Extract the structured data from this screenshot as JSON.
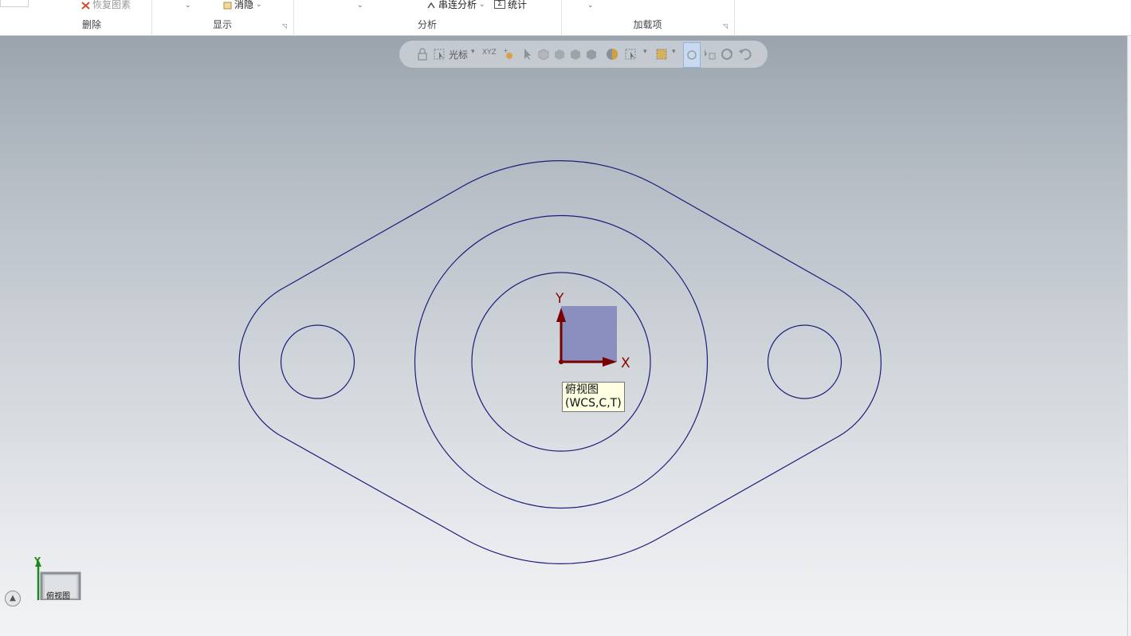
{
  "ribbon": {
    "groups": [
      {
        "label": "删除",
        "items": [
          {
            "label": "恢复图素",
            "icon": "restore-entity-icon"
          }
        ]
      },
      {
        "label": "显示",
        "items": [
          {
            "label": "消隐",
            "icon": "hide-icon"
          }
        ]
      },
      {
        "label": "分析",
        "items": [
          {
            "label": "串连分析",
            "icon": "chain-analysis-icon"
          },
          {
            "label": "统计",
            "icon": "sigma-statistics-icon"
          }
        ]
      },
      {
        "label": "加载项",
        "items": []
      }
    ]
  },
  "view_toolbar": {
    "cursor_label": "光标",
    "xyz_label": "XYZ"
  },
  "gnomon": {
    "x_label": "X",
    "y_label": "Y",
    "plane_color": "#8a8fc0",
    "axis_color": "#7a0000"
  },
  "tooltip": {
    "line1": "俯视图",
    "line2": "(WCS,C,T)"
  },
  "view_cube": {
    "label": "俯视图",
    "y_label": "Y"
  },
  "colors": {
    "geometry": "#1c1c7c",
    "viewport_top": "#9ba4ae",
    "viewport_bottom": "#f2f3f5"
  }
}
